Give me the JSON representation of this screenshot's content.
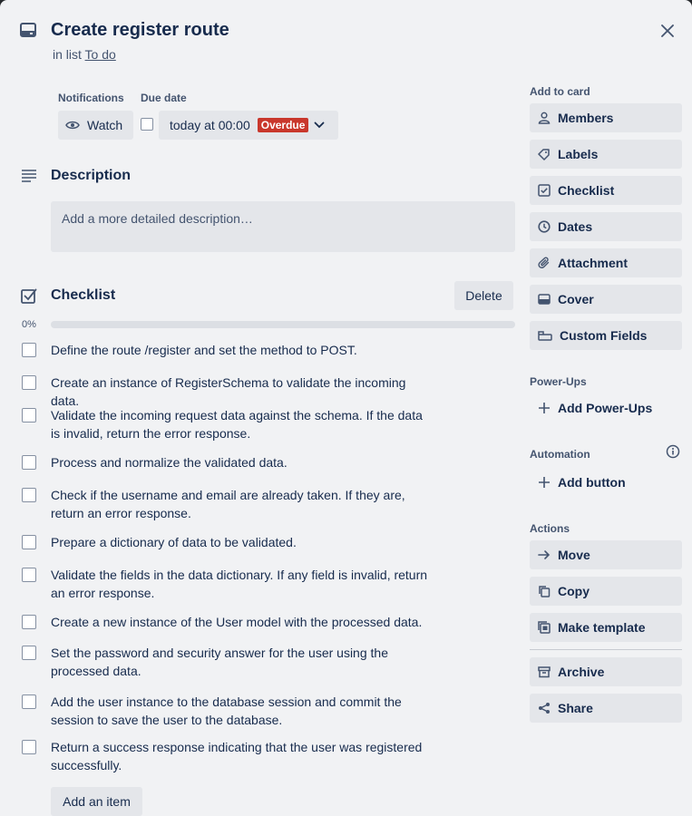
{
  "card": {
    "title": "Create register route",
    "list_prefix": "in list",
    "list_name": "To do"
  },
  "notifications": {
    "label": "Notifications",
    "watch_label": "Watch"
  },
  "due_date": {
    "label": "Due date",
    "value": "today at 00:00",
    "badge": "Overdue"
  },
  "description": {
    "title": "Description",
    "placeholder": "Add a more detailed description…"
  },
  "checklist": {
    "title": "Checklist",
    "delete_label": "Delete",
    "percent": "0%",
    "progress": 0,
    "items": [
      {
        "text": "Define the route /register and set the method to POST.",
        "checked": false
      },
      {
        "text": "Create an instance of RegisterSchema to validate the incoming data.",
        "checked": false
      },
      {
        "text": "Validate the incoming request data against the schema. If the data is invalid, return the error response.",
        "checked": false
      },
      {
        "text": "Process and normalize the validated data.",
        "checked": false
      },
      {
        "text": "Check if the username and email are already taken. If they are, return an error response.",
        "checked": false
      },
      {
        "text": "Prepare a dictionary of data to be validated.",
        "checked": false
      },
      {
        "text": "Validate the fields in the data dictionary. If any field is invalid, return an error response.",
        "checked": false
      },
      {
        "text": "Create a new instance of the User model with the processed data.",
        "checked": false
      },
      {
        "text": "Set the password and security answer for the user using the processed data.",
        "checked": false
      },
      {
        "text": "Add the user instance to the database session and commit the session to save the user to the database.",
        "checked": false
      },
      {
        "text": "Return a success response indicating that the user was registered successfully.",
        "checked": false
      }
    ],
    "add_item_label": "Add an item"
  },
  "sidebar": {
    "add_to_card_label": "Add to card",
    "add_to_card": [
      {
        "label": "Members",
        "icon": "person-icon"
      },
      {
        "label": "Labels",
        "icon": "tag-icon"
      },
      {
        "label": "Checklist",
        "icon": "checklist-icon"
      },
      {
        "label": "Dates",
        "icon": "clock-icon"
      },
      {
        "label": "Attachment",
        "icon": "paperclip-icon"
      },
      {
        "label": "Cover",
        "icon": "cover-icon"
      },
      {
        "label": "Custom Fields",
        "icon": "custom-fields-icon"
      }
    ],
    "powerups_label": "Power-Ups",
    "add_powerups_label": "Add Power-Ups",
    "automation_label": "Automation",
    "add_button_label": "Add button",
    "actions_label": "Actions",
    "actions": [
      {
        "label": "Move",
        "icon": "arrow-right-icon"
      },
      {
        "label": "Copy",
        "icon": "copy-icon"
      },
      {
        "label": "Make template",
        "icon": "template-icon"
      },
      {
        "label": "Archive",
        "icon": "archive-icon"
      },
      {
        "label": "Share",
        "icon": "share-icon"
      }
    ]
  },
  "colors": {
    "overdue": "#c9372c",
    "background": "#f1f2f4",
    "button": "#e4e6ea"
  }
}
